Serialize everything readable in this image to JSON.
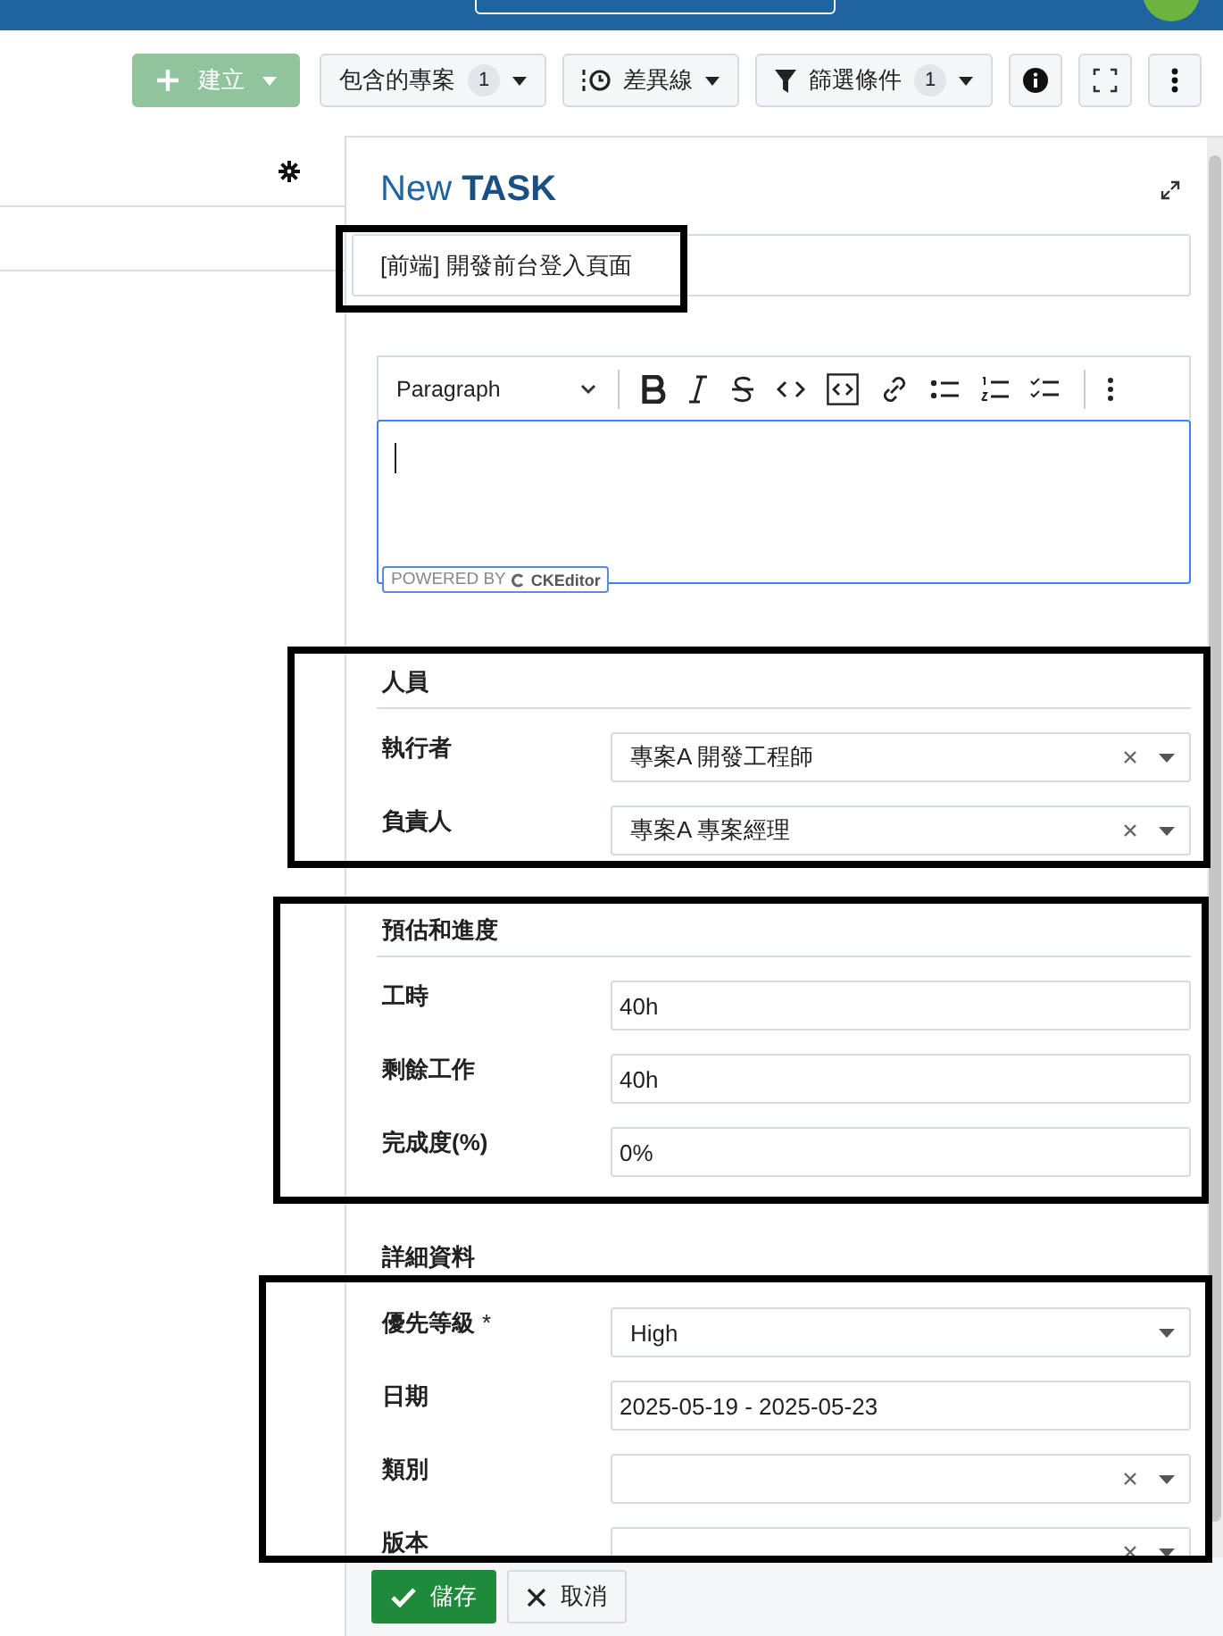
{
  "toolbar": {
    "create_button": "建立",
    "included_projects": {
      "label": "包含的專案",
      "count": "1"
    },
    "baseline": "差異線",
    "filter": {
      "label": "篩選條件",
      "count": "1"
    }
  },
  "task_form": {
    "title_prefix": "New",
    "title_type": "TASK",
    "subject": "[前端] 開發前台登入頁面",
    "editor": {
      "heading_style": "Paragraph",
      "powered_by": "POWERED BY",
      "brand": "CKEditor"
    },
    "sections": [
      {
        "title": "人員",
        "fields": [
          {
            "label": "執行者",
            "kind": "select",
            "value": "專案A 開發工程師",
            "clearable": true
          },
          {
            "label": "負責人",
            "kind": "select",
            "value": "專案A 專案經理",
            "clearable": true
          }
        ]
      },
      {
        "title": "預估和進度",
        "fields": [
          {
            "label": "工時",
            "kind": "text",
            "value": "40h"
          },
          {
            "label": "剩餘工作",
            "kind": "text",
            "value": "40h"
          },
          {
            "label": "完成度(%)",
            "kind": "text",
            "value": "0%"
          }
        ]
      },
      {
        "title": "詳細資料",
        "fields": [
          {
            "label": "優先等級",
            "marker": "*",
            "kind": "select",
            "value": "High",
            "clearable": false
          },
          {
            "label": "日期",
            "kind": "text",
            "value": "2025-05-19 - 2025-05-23"
          },
          {
            "label": "類別",
            "kind": "select",
            "clearable": true
          },
          {
            "label": "版本",
            "kind": "select",
            "clearable": true
          }
        ]
      }
    ]
  },
  "actions": {
    "save": "儲存",
    "cancel": "取消"
  }
}
